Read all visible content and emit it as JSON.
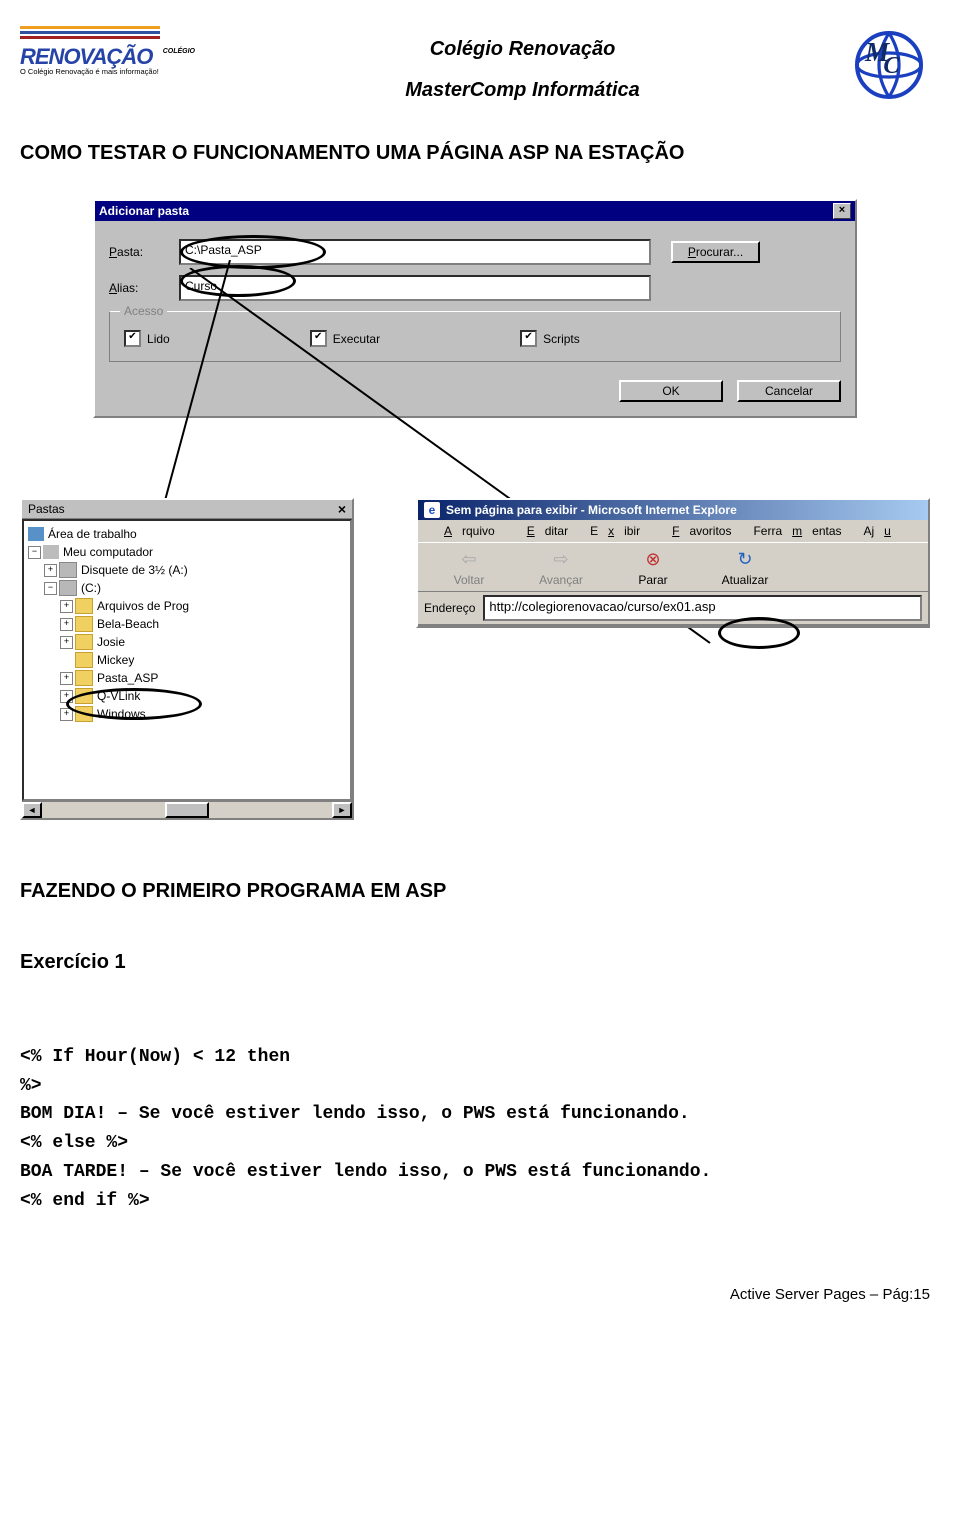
{
  "header": {
    "logo_left": {
      "small": "COLÉGIO",
      "brand": "RENOVAÇÃO",
      "tag": "O Colégio Renovação é mais informação!"
    },
    "title1": "Colégio Renovação",
    "title2": "MasterComp Informática"
  },
  "heading1": "COMO TESTAR O FUNCIONAMENTO  UMA PÁGINA ASP NA ESTAÇÃO",
  "dlg": {
    "title": "Adicionar pasta",
    "pasta_label": "Pasta:",
    "pasta_label_ul": "P",
    "pasta_value": "C:\\Pasta_ASP",
    "procurar": "Procurar...",
    "alias_label": "Alias:",
    "alias_label_ul": "A",
    "alias_value": "Curso",
    "acesso_legend": "Acesso",
    "lido": "Lido",
    "lido_ul": "L",
    "executar": "Executar",
    "executar_ul": "E",
    "scripts": "Scripts",
    "scripts_ul": "S",
    "ok": "OK",
    "cancelar": "Cancelar"
  },
  "folders": {
    "title": "Pastas",
    "items": [
      {
        "indent": 0,
        "pm": "",
        "icon": "desktop",
        "label": "Área de trabalho"
      },
      {
        "indent": 0,
        "pm": "−",
        "icon": "computer",
        "label": "Meu computador"
      },
      {
        "indent": 1,
        "pm": "+",
        "icon": "drive",
        "label": "Disquete de 3½ (A:)"
      },
      {
        "indent": 1,
        "pm": "−",
        "icon": "drive",
        "label": "(C:)"
      },
      {
        "indent": 2,
        "pm": "+",
        "icon": "folder",
        "label": "Arquivos de Prog"
      },
      {
        "indent": 2,
        "pm": "+",
        "icon": "folder",
        "label": "Bela-Beach"
      },
      {
        "indent": 2,
        "pm": "+",
        "icon": "folder",
        "label": "Josie"
      },
      {
        "indent": 2,
        "pm": "",
        "icon": "folder",
        "label": "Mickey"
      },
      {
        "indent": 2,
        "pm": "+",
        "icon": "folder",
        "label": "Pasta_ASP"
      },
      {
        "indent": 2,
        "pm": "+",
        "icon": "folder",
        "label": "Q-VLink"
      },
      {
        "indent": 2,
        "pm": "+",
        "icon": "folder",
        "label": "Windows"
      }
    ]
  },
  "browser": {
    "title": "Sem página para exibir - Microsoft Internet Explore",
    "menus": {
      "arquivo": "Arquivo",
      "ar_ul": "A",
      "editar": "Editar",
      "ed_ul": "E",
      "exibir": "Exibir",
      "ex_ul": "x",
      "fav": "Favoritos",
      "fa_ul": "F",
      "ferr": "Ferramentas",
      "fe_ul": "m",
      "aju": "Aju",
      "aj_ul": "u"
    },
    "buttons": {
      "voltar": "Voltar",
      "avancar": "Avançar",
      "parar": "Parar",
      "atualizar": "Atualizar"
    },
    "addr_label": "Endereço",
    "addr_ul": "ç",
    "url": "http://colegiorenovacao/curso/ex01.asp"
  },
  "heading2": "FAZENDO O PRIMEIRO PROGRAMA EM ASP",
  "exercise": "Exercício 1",
  "code": {
    "l1": "<% If Hour(Now) < 12 then",
    "l2": "%>",
    "l3": "BOM DIA! – Se você estiver lendo isso, o PWS está funcionando.",
    "l4": "<% else %>",
    "l5": "BOA TARDE! – Se você estiver lendo isso, o PWS está funcionando.",
    "l6": "<% end if %>"
  },
  "footer": "Active Server Pages – Pág:15"
}
